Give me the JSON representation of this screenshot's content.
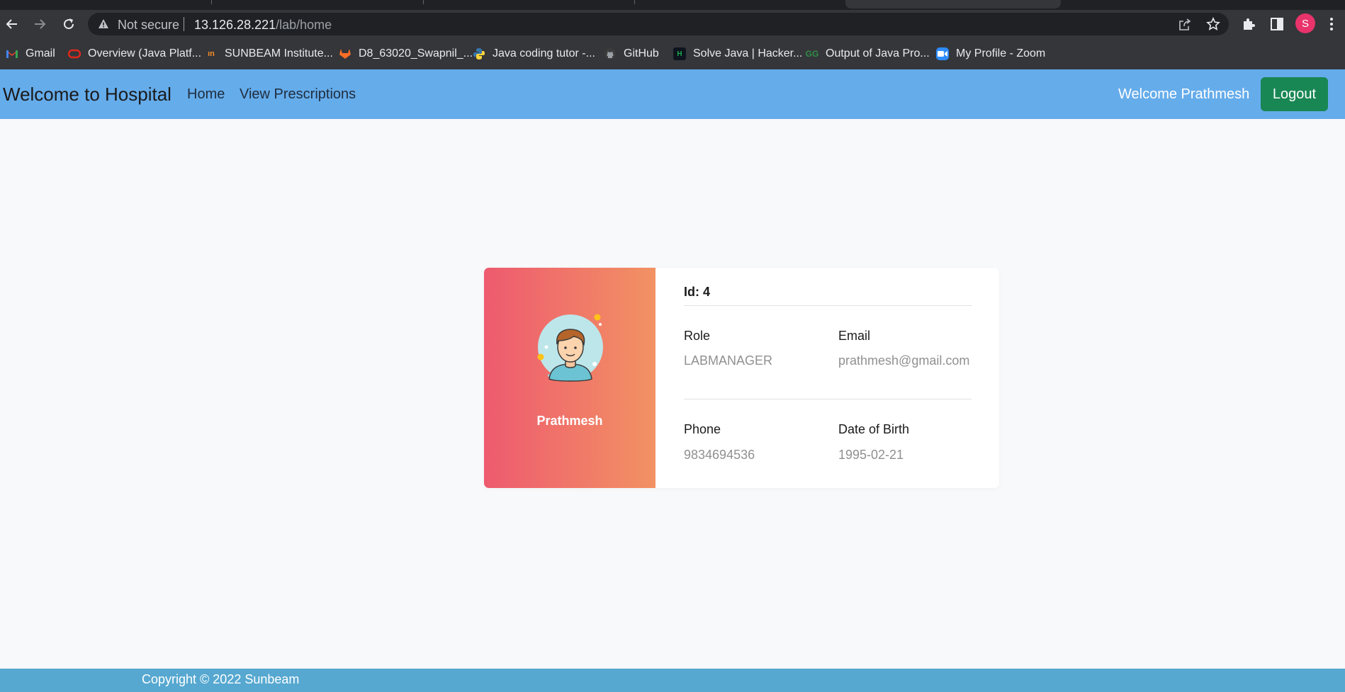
{
  "browser": {
    "omnibox": {
      "security_label": "Not secure",
      "url_host": "13.126.28.221",
      "url_path": "/lab/home"
    },
    "profile_initial": "S",
    "bookmarks": [
      {
        "label": "Gmail",
        "icon": "gmail-icon",
        "color": "#ea4335"
      },
      {
        "label": "Overview (Java Platf...",
        "icon": "oracle-icon",
        "color": "#e0281b"
      },
      {
        "label": "SUNBEAM Institute...",
        "icon": "sunbeam-icon",
        "color": "#f28c28"
      },
      {
        "label": "D8_63020_Swapnil_...",
        "icon": "gitlab-icon",
        "color": "#fc6d26"
      },
      {
        "label": "Java coding tutor -...",
        "icon": "python-icon",
        "color": "#3776ab"
      },
      {
        "label": "GitHub",
        "icon": "github-icon",
        "color": "#9aa0a6"
      },
      {
        "label": "Solve Java | Hacker...",
        "icon": "hackerrank-icon",
        "color": "#1ba94c"
      },
      {
        "label": "Output of Java Pro...",
        "icon": "geeksforgeeks-icon",
        "color": "#2f8d46"
      },
      {
        "label": "My Profile - Zoom",
        "icon": "zoom-icon",
        "color": "#2d8cff"
      }
    ]
  },
  "nav": {
    "brand": "Welcome to Hospital",
    "links": [
      "Home",
      "View Prescriptions"
    ],
    "welcome": "Welcome Prathmesh",
    "logout": "Logout"
  },
  "profile": {
    "name": "Prathmesh",
    "id_label": "Id: 4",
    "fields": [
      {
        "label": "Role",
        "value": "LABMANAGER"
      },
      {
        "label": "Email",
        "value": "prathmesh@gmail.com"
      },
      {
        "label": "Phone",
        "value": "9834694536"
      },
      {
        "label": "Date of Birth",
        "value": "1995-02-21"
      }
    ]
  },
  "footer": {
    "copyright": "Copyright © 2022 Sunbeam"
  },
  "colors": {
    "navbar": "#65aceb",
    "logout": "#198754",
    "card_gradient_start": "#ee5a6f",
    "card_gradient_end": "#f29263",
    "footer": "#56a8d0"
  }
}
